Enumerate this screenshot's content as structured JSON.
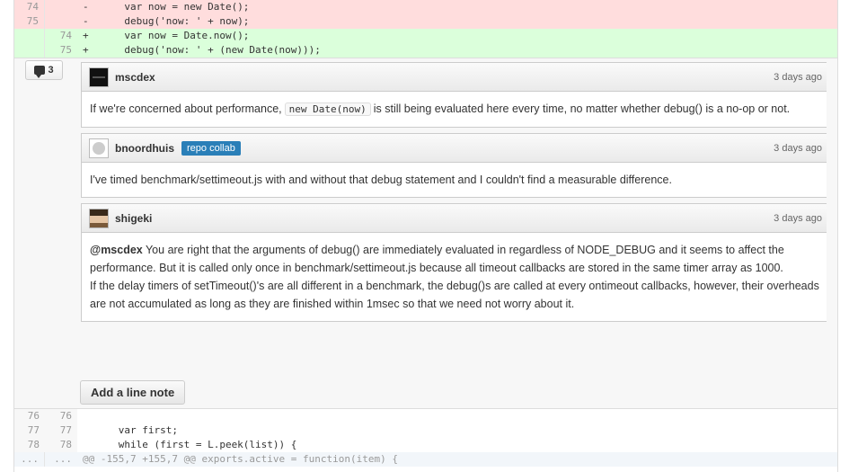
{
  "diff_top": [
    {
      "type": "del",
      "old": "74",
      "new": "",
      "marker": "-",
      "code": "      var now = new Date();"
    },
    {
      "type": "del",
      "old": "75",
      "new": "",
      "marker": "-",
      "code": "      debug('now: ' + now);"
    },
    {
      "type": "add",
      "old": "",
      "new": "74",
      "marker": "+",
      "code": "      var now = Date.now();"
    },
    {
      "type": "add",
      "old": "",
      "new": "75",
      "marker": "+",
      "code": "      debug('now: ' + (new Date(now)));"
    }
  ],
  "comment_count": "3",
  "comments": [
    {
      "author": "mscdex",
      "time": "3 days ago",
      "body_pre": "If we're concerned about performance,",
      "body_code": "new Date(now)",
      "body_post": "is still being evaluated here every time, no matter whether debug() is a no-op or not."
    },
    {
      "author": "bnoordhuis",
      "badge": "repo collab",
      "time": "3 days ago",
      "body": "I've timed benchmark/settimeout.js with and without that debug statement and I couldn't find a measurable difference."
    },
    {
      "author": "shigeki",
      "time": "3 days ago",
      "mention": "@mscdex",
      "body_p1": " You are right that the arguments of debug() are immediately evaluated in regardless of NODE_DEBUG and it seems to affect the performance. But it is called only once in benchmark/settimeout.js because all timeout callbacks are stored in the same timer array as 1000.",
      "body_p2": "If the delay timers of setTimeout()'s are all different in a benchmark, the debug()s are called at every ontimeout callbacks, however, their overheads are not accumulated as long as they are finished within 1msec so that we need not worry about it."
    }
  ],
  "add_note_label": "Add a line note",
  "diff_bottom": [
    {
      "type": "plain",
      "old": "76",
      "new": "76",
      "marker": "",
      "code": ""
    },
    {
      "type": "plain",
      "old": "77",
      "new": "77",
      "marker": "",
      "code": "      var first;"
    },
    {
      "type": "plain",
      "old": "78",
      "new": "78",
      "marker": "",
      "code": "      while (first = L.peek(list)) {"
    },
    {
      "type": "hunk",
      "old": "...",
      "new": "...",
      "marker": "",
      "code": "@@ -155,7 +155,7 @@ exports.active = function(item) {"
    }
  ]
}
